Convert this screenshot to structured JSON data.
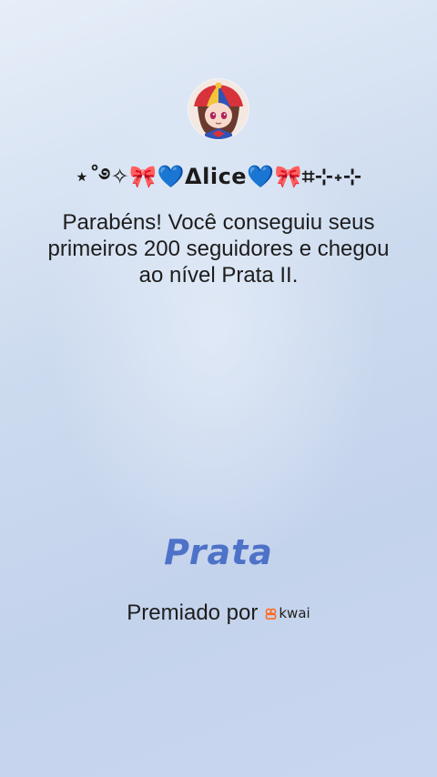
{
  "profile": {
    "username": "⋆˚࿔✧🎀💙Δlice💙🎀⌗⊹˖⊹"
  },
  "message": "Parabéns! Você conseguiu seus primeiros 200 seguidores e chegou ao nível Prata II.",
  "level": {
    "title": "Prata",
    "title_color": "#4d72c8"
  },
  "award": {
    "label": "Premiado por",
    "brand": "kwai",
    "brand_color": "#ff6a1f"
  },
  "icons": {
    "avatar": "avatar-image",
    "brand_logo": "kwai-logo-icon"
  }
}
